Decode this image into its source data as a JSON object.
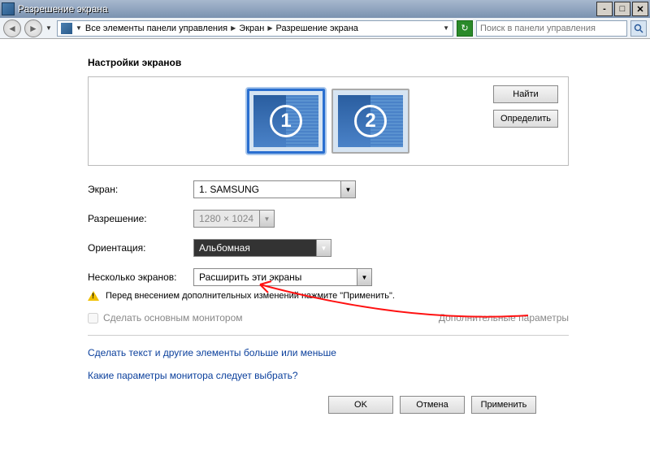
{
  "window": {
    "title": "Разрешение экрана"
  },
  "breadcrumb": {
    "root": "Все элементы панели управления",
    "mid": "Экран",
    "leaf": "Разрешение экрана"
  },
  "search": {
    "placeholder": "Поиск в панели управления"
  },
  "heading": "Настройки экранов",
  "monitors": {
    "m1": "1",
    "m2": "2"
  },
  "panel": {
    "find": "Найти",
    "identify": "Определить"
  },
  "form": {
    "screen_label": "Экран:",
    "screen_value": "1. SAMSUNG",
    "res_label": "Разрешение:",
    "res_value": "1280 × 1024",
    "orient_label": "Ориентация:",
    "orient_value": "Альбомная",
    "multi_label": "Несколько экранов:",
    "multi_value": "Расширить эти экраны"
  },
  "warning": "Перед внесением дополнительных изменений нажмите \"Применить\".",
  "primary_cb": "Сделать основным монитором",
  "adv": "Дополнительные параметры",
  "links": {
    "text_size": "Сделать текст и другие элементы больше или меньше",
    "which_monitor": "Какие параметры монитора следует выбрать?"
  },
  "buttons": {
    "ok": "OK",
    "cancel": "Отмена",
    "apply": "Применить"
  }
}
